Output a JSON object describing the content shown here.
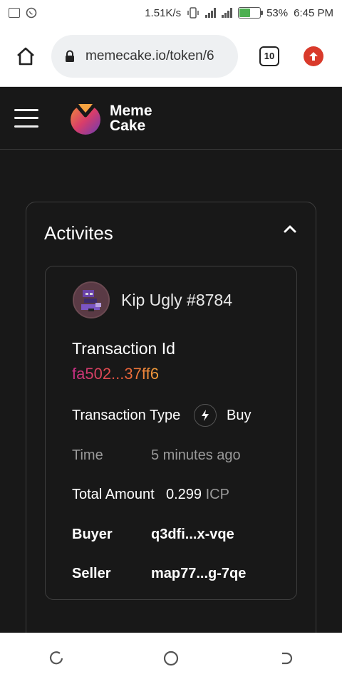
{
  "status_bar": {
    "network_speed": "1.51K/s",
    "battery": "53%",
    "battery_level": 0.53,
    "time": "6:45 PM"
  },
  "browser": {
    "url": "memecake.io/token/6",
    "tab_count": "10"
  },
  "site": {
    "brand_line1": "Meme",
    "brand_line2": "Cake"
  },
  "activity": {
    "title": "Activites",
    "nft_name": "Kip Ugly #8784",
    "transaction_id_label": "Transaction Id",
    "transaction_id": "fa502...37ff6",
    "transaction_type_label": "Transaction Type",
    "transaction_type": "Buy",
    "time_label": "Time",
    "time_value": "5 minutes ago",
    "total_amount_label": "Total Amount",
    "total_amount": "0.299",
    "total_amount_unit": "ICP",
    "buyer_label": "Buyer",
    "buyer": "q3dfi...x-vqe",
    "seller_label": "Seller",
    "seller": "map77...g-7qe"
  },
  "colors": {
    "accent_gradient_start": "#c72e88",
    "accent_gradient_end": "#f3a23b",
    "update_red": "#d93a2b"
  }
}
